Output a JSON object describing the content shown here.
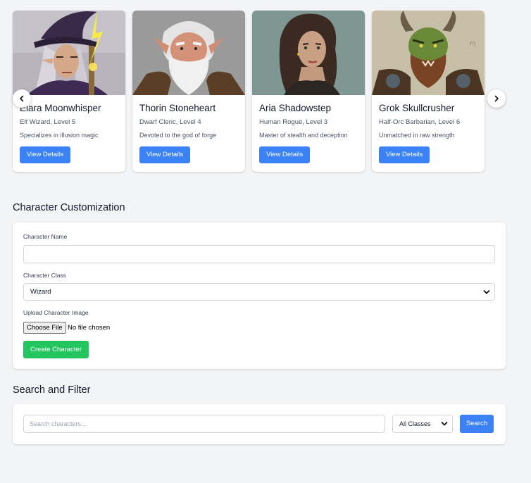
{
  "carousel": {
    "characters": [
      {
        "name": "Elara Moonwhisper",
        "subtitle": "Elf Wizard, Level 5",
        "description": "Specializes in illusion magic",
        "button_label": "View Details",
        "icon": "elf-wizard-portrait"
      },
      {
        "name": "Thorin Stoneheart",
        "subtitle": "Dwarf Cleric, Level 4",
        "description": "Devoted to the god of forge",
        "button_label": "View Details",
        "icon": "dwarf-cleric-portrait"
      },
      {
        "name": "Aria Shadowstep",
        "subtitle": "Human Rogue, Level 3",
        "description": "Master of stealth and deception",
        "button_label": "View Details",
        "icon": "human-rogue-portrait"
      },
      {
        "name": "Grok Skullcrusher",
        "subtitle": "Half-Orc Barbarian, Level 6",
        "description": "Unmatched in raw strength",
        "button_label": "View Details",
        "icon": "half-orc-barbarian-portrait"
      }
    ],
    "prev_icon": "chevron-left-icon",
    "next_icon": "chevron-right-icon"
  },
  "customization": {
    "title": "Character Customization",
    "name_label": "Character Name",
    "name_value": "",
    "class_label": "Character Class",
    "class_selected": "Wizard",
    "upload_label": "Upload Character Image",
    "file_button": "Choose File",
    "file_status": "No file chosen",
    "create_button": "Create Character"
  },
  "search": {
    "title": "Search and Filter",
    "placeholder": "Search characters...",
    "filter_selected": "All Classes",
    "button": "Search"
  },
  "colors": {
    "primary": "#3b82f6",
    "success": "#22c55e",
    "background": "#f3f4f6"
  }
}
